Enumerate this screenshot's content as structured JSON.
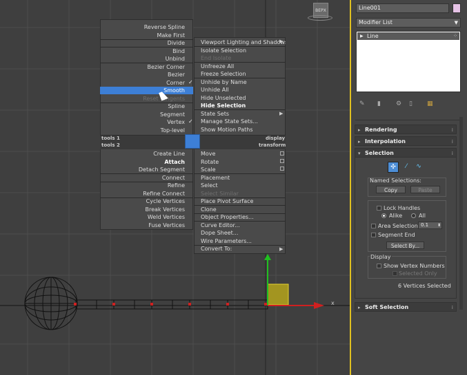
{
  "viewport": {
    "cube_label": "ВЕРХ",
    "axis_x_label": "x"
  },
  "quad_menu": {
    "left_top": [
      "Reverse Spline",
      "Make First",
      "Divide",
      "Bind",
      "Unbind",
      "Bezier Corner",
      "Bezier",
      "Corner",
      "Smooth",
      "Reset Tangents",
      "Spline",
      "Segment",
      "Vertex",
      "Top-level"
    ],
    "right_top": [
      "Viewport Lighting and Shadows",
      "Isolate Selection",
      "End Isolate",
      "Unfreeze All",
      "Freeze Selection",
      "Unhide by Name",
      "Unhide All",
      "Hide Unselected",
      "Hide Selection",
      "State Sets",
      "Manage State Sets...",
      "Show Motion Paths"
    ],
    "tools1": "tools 1",
    "tools2": "tools 2",
    "display": "display",
    "transform": "transform",
    "left_bottom": [
      "Create Line",
      "Attach",
      "Detach Segment",
      "Connect",
      "Refine",
      "Refine Connect",
      "Cycle Vertices",
      "Break Vertices",
      "Weld Vertices",
      "Fuse Vertices"
    ],
    "right_bottom": [
      "Move",
      "Rotate",
      "Scale",
      "Placement",
      "Select",
      "Select Similar",
      "Place Pivot Surface",
      "Clone",
      "Object Properties...",
      "Curve Editor...",
      "Dope Sheet...",
      "Wire Parameters...",
      "Convert To:"
    ]
  },
  "panel": {
    "object_name": "Line001",
    "modifier_list": "Modifier List",
    "stack_item": "Line",
    "rollouts": {
      "rendering": "Rendering",
      "interpolation": "Interpolation",
      "selection": "Selection",
      "soft_selection": "Soft Selection"
    },
    "named_selections": "Named Selections:",
    "copy": "Copy",
    "paste": "Paste",
    "lock_handles": "Lock Handles",
    "alike": "Alike",
    "all": "All",
    "area_selection": "Area Selection:",
    "area_value": "0.1",
    "segment_end": "Segment End",
    "select_by": "Select By...",
    "display": "Display",
    "show_vertex_numbers": "Show Vertex Numbers",
    "selected_only": "Selected Only",
    "status": "6 Vertices Selected",
    "swatch_color": "#e6c3e6"
  }
}
